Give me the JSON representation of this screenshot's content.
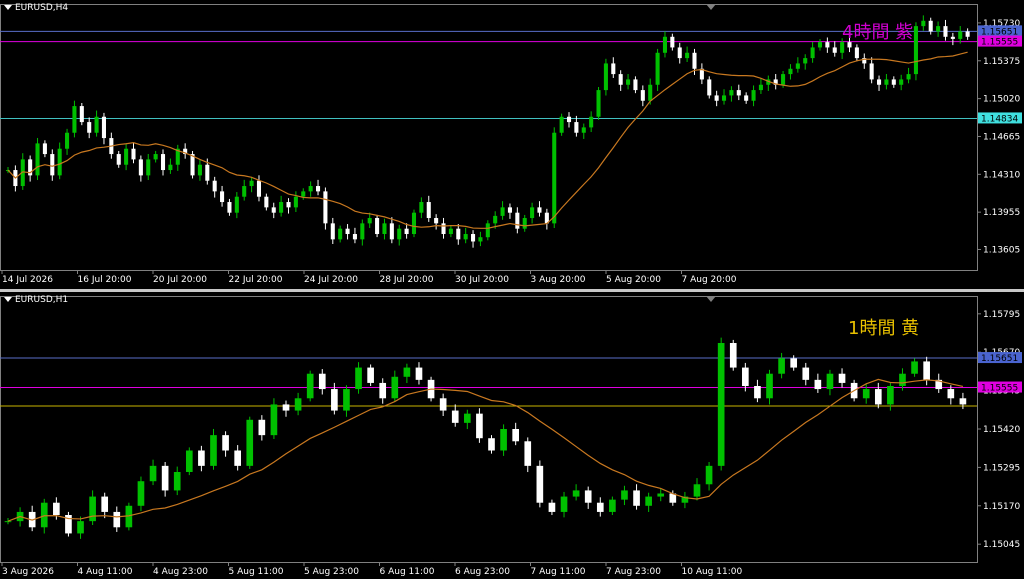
{
  "colors": {
    "bull": "#00c000",
    "bear": "#ffffff",
    "ma": "#c87820",
    "grid": "#404040",
    "text": "#ffffff",
    "blue": "#5a6ec8",
    "magenta": "#e000e0",
    "cyan": "#40c0c0",
    "yellow": "#c8b400"
  },
  "chart_data": [
    {
      "type": "candlestick",
      "symbol": "EURUSD,H4",
      "annotation": "4時間  紫",
      "ylim": [
        1.1345,
        1.1587
      ],
      "ticks": [
        "1.15730",
        "1.15375",
        "1.15020",
        "1.14665",
        "1.14310",
        "1.13955",
        "1.13605"
      ],
      "tick_values": [
        1.1573,
        1.15375,
        1.1502,
        1.14665,
        1.1431,
        1.13955,
        1.13605
      ],
      "x_labels": [
        "14 Jul 2026",
        "16 Jul 20:00",
        "20 Jul 20:00",
        "22 Jul 20:00",
        "24 Jul 20:00",
        "28 Jul 20:00",
        "30 Jul 20:00",
        "3 Aug 20:00",
        "5 Aug 20:00",
        "7 Aug 20:00"
      ],
      "hlines": [
        {
          "value": 1.15651,
          "label": "1.15651",
          "color": "#5a6ec8",
          "boxColor": "#4a64d0"
        },
        {
          "value": 1.15555,
          "label": "1.15555",
          "color": "#e000e0",
          "boxColor": "#e000e0"
        },
        {
          "value": 1.14834,
          "label": "1.14834",
          "color": "#40c0c0",
          "boxColor": "#40e0e0"
        }
      ],
      "closes": [
        1.1435,
        1.142,
        1.1445,
        1.143,
        1.146,
        1.145,
        1.143,
        1.1455,
        1.147,
        1.1495,
        1.148,
        1.147,
        1.1485,
        1.1465,
        1.145,
        1.144,
        1.1455,
        1.1445,
        1.143,
        1.1445,
        1.145,
        1.1435,
        1.144,
        1.1455,
        1.145,
        1.143,
        1.144,
        1.1425,
        1.1415,
        1.1405,
        1.1395,
        1.141,
        1.142,
        1.1425,
        1.141,
        1.14,
        1.1395,
        1.1405,
        1.14,
        1.141,
        1.1415,
        1.142,
        1.1415,
        1.1385,
        1.137,
        1.138,
        1.1375,
        1.137,
        1.1385,
        1.139,
        1.1375,
        1.1385,
        1.137,
        1.138,
        1.1375,
        1.1395,
        1.1405,
        1.139,
        1.1385,
        1.1375,
        1.138,
        1.137,
        1.1375,
        1.1368,
        1.1372,
        1.1385,
        1.1392,
        1.14,
        1.1395,
        1.138,
        1.139,
        1.14,
        1.1395,
        1.1385,
        1.147,
        1.1485,
        1.148,
        1.147,
        1.1475,
        1.1485,
        1.151,
        1.1535,
        1.1525,
        1.1515,
        1.152,
        1.151,
        1.15,
        1.1515,
        1.1545,
        1.156,
        1.155,
        1.154,
        1.1545,
        1.153,
        1.152,
        1.1505,
        1.15,
        1.1505,
        1.151,
        1.1505,
        1.15,
        1.151,
        1.1515,
        1.152,
        1.1515,
        1.1525,
        1.153,
        1.1535,
        1.154,
        1.155,
        1.1555,
        1.155,
        1.1545,
        1.1555,
        1.155,
        1.154,
        1.1535,
        1.152,
        1.1515,
        1.152,
        1.1515,
        1.152,
        1.1525,
        1.157,
        1.1575,
        1.1565,
        1.157,
        1.156,
        1.1558,
        1.1565,
        1.156
      ]
    },
    {
      "type": "candlestick",
      "symbol": "EURUSD,H1",
      "annotation": "1時間  黄",
      "ylim": [
        1.15,
        1.1584
      ],
      "ticks": [
        "1.15795",
        "1.15670",
        "1.15545",
        "1.15420",
        "1.15295",
        "1.15170",
        "1.15045"
      ],
      "tick_values": [
        1.15795,
        1.1567,
        1.15545,
        1.1542,
        1.15295,
        1.1517,
        1.15045
      ],
      "x_labels": [
        "3 Aug 2026",
        "4 Aug 11:00",
        "4 Aug 23:00",
        "5 Aug 11:00",
        "5 Aug 23:00",
        "6 Aug 11:00",
        "6 Aug 23:00",
        "7 Aug 11:00",
        "7 Aug 23:00",
        "10 Aug 11:00"
      ],
      "hlines": [
        {
          "value": 1.15651,
          "label": "1.15651",
          "color": "#5a6ec8",
          "boxColor": "#4a64d0"
        },
        {
          "value": 1.15555,
          "label": "1.15555",
          "color": "#e000e0",
          "boxColor": "#e000e0"
        },
        {
          "value": 1.15495,
          "label": "",
          "color": "#c8b400",
          "boxColor": ""
        }
      ],
      "closes": [
        1.1512,
        1.1515,
        1.151,
        1.1518,
        1.1514,
        1.1508,
        1.1512,
        1.152,
        1.1515,
        1.151,
        1.1517,
        1.1525,
        1.153,
        1.1522,
        1.1528,
        1.1535,
        1.153,
        1.154,
        1.1535,
        1.153,
        1.1545,
        1.154,
        1.155,
        1.1548,
        1.1552,
        1.156,
        1.1555,
        1.1548,
        1.1555,
        1.1562,
        1.1557,
        1.1552,
        1.1559,
        1.1562,
        1.1558,
        1.1552,
        1.1548,
        1.1544,
        1.1547,
        1.1539,
        1.1535,
        1.1542,
        1.1538,
        1.153,
        1.1518,
        1.1515,
        1.152,
        1.1522,
        1.1518,
        1.1515,
        1.1519,
        1.1522,
        1.1517,
        1.152,
        1.1521,
        1.1518,
        1.152,
        1.1524,
        1.153,
        1.157,
        1.1562,
        1.1556,
        1.1552,
        1.156,
        1.1565,
        1.1562,
        1.1558,
        1.1555,
        1.156,
        1.1557,
        1.1552,
        1.1555,
        1.155,
        1.1556,
        1.156,
        1.1564,
        1.1558,
        1.1555,
        1.1552,
        1.155
      ]
    }
  ]
}
